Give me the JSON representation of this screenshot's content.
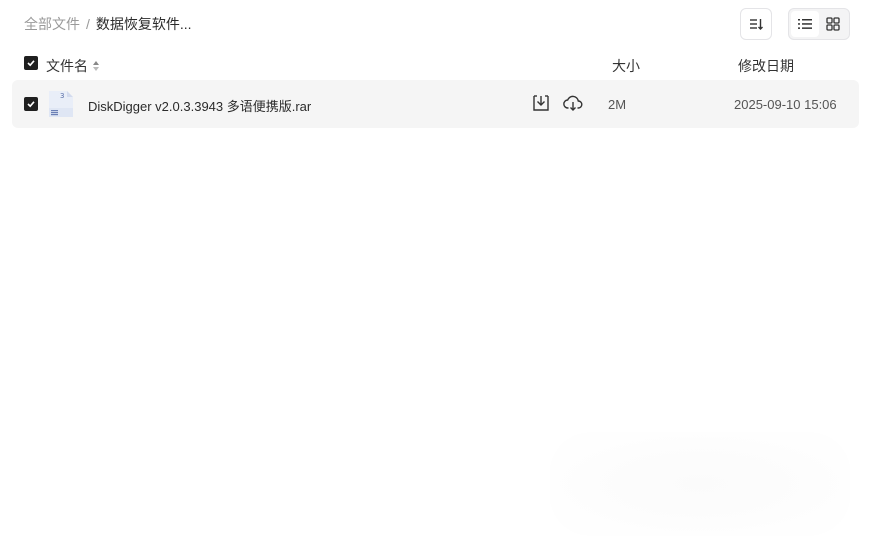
{
  "breadcrumb": {
    "root": "全部文件",
    "separator": "/",
    "current": "数据恢复软件..."
  },
  "toolbar": {
    "sort_icon": "sort-list-icon",
    "views": [
      {
        "name": "list-view-icon",
        "active": true
      },
      {
        "name": "grid-view-icon",
        "active": false
      }
    ]
  },
  "columns": {
    "name": "文件名",
    "size": "大小",
    "date": "修改日期"
  },
  "files": [
    {
      "checked": true,
      "icon": "rar-archive-icon",
      "name": "DiskDigger v2.0.3.3943 多语便携版.rar",
      "size": "2M",
      "modified": "2025-09-10 15:06"
    }
  ],
  "colors": {
    "row_bg": "#f5f5f5",
    "checkbox": "#1f1f1f",
    "muted_text": "#9a9a9a"
  }
}
